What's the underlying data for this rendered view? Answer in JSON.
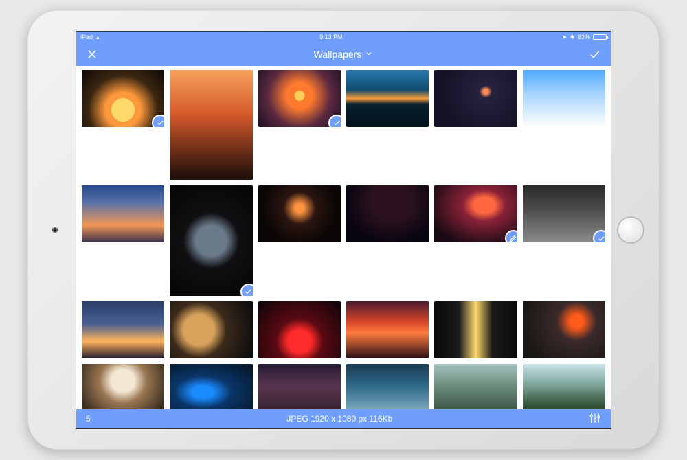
{
  "status": {
    "carrier": "iPad",
    "time": "9:13 PM",
    "battery_pct": "83%"
  },
  "nav": {
    "title": "Wallpapers",
    "close_icon": "close-icon",
    "confirm_icon": "check-icon",
    "dropdown_icon": "chevron-down-icon"
  },
  "footer": {
    "selected_count": "5",
    "detail": "JPEG 1920 x 1080 px 116Kb",
    "settings_icon": "sliders-icon"
  },
  "thumbnails": [
    {
      "name": "moon-reflection",
      "tall": false,
      "selected": true,
      "badge": "check"
    },
    {
      "name": "surfer-sunset",
      "tall": true,
      "selected": false,
      "badge": null
    },
    {
      "name": "neon-city",
      "tall": false,
      "selected": true,
      "badge": "check"
    },
    {
      "name": "forest-sunset",
      "tall": false,
      "selected": false,
      "badge": null
    },
    {
      "name": "crescent-moon",
      "tall": false,
      "selected": false,
      "badge": null
    },
    {
      "name": "anime-clouds",
      "tall": false,
      "selected": false,
      "badge": null
    },
    {
      "name": "purple-dusk",
      "tall": false,
      "selected": false,
      "badge": null
    },
    {
      "name": "earth-dark",
      "tall": true,
      "selected": true,
      "badge": "check"
    },
    {
      "name": "lake-reflection",
      "tall": false,
      "selected": false,
      "badge": null
    },
    {
      "name": "sparks-night",
      "tall": false,
      "selected": false,
      "badge": null
    },
    {
      "name": "red-nebula",
      "tall": false,
      "selected": false,
      "badge": "pencil"
    },
    {
      "name": "skyscrapers",
      "tall": false,
      "selected": true,
      "badge": "check"
    },
    {
      "name": "milky-way-shore",
      "tall": false,
      "selected": false,
      "badge": null
    },
    {
      "name": "jupiter",
      "tall": false,
      "selected": false,
      "badge": null
    },
    {
      "name": "red-smoke",
      "tall": false,
      "selected": false,
      "badge": null
    },
    {
      "name": "fire-clouds",
      "tall": false,
      "selected": false,
      "badge": null
    },
    {
      "name": "sun-through-trees",
      "tall": false,
      "selected": false,
      "badge": null
    },
    {
      "name": "volcano",
      "tall": false,
      "selected": false,
      "badge": null
    },
    {
      "name": "explosion-cloud",
      "tall": false,
      "selected": false,
      "badge": null
    },
    {
      "name": "ice-cave",
      "tall": false,
      "selected": false,
      "badge": null
    },
    {
      "name": "purple-ridges",
      "tall": false,
      "selected": false,
      "badge": null
    },
    {
      "name": "sci-fi-tower",
      "tall": false,
      "selected": false,
      "badge": null
    },
    {
      "name": "pagoda-lake",
      "tall": false,
      "selected": false,
      "badge": null
    },
    {
      "name": "green-mountain",
      "tall": false,
      "selected": false,
      "badge": null
    }
  ]
}
